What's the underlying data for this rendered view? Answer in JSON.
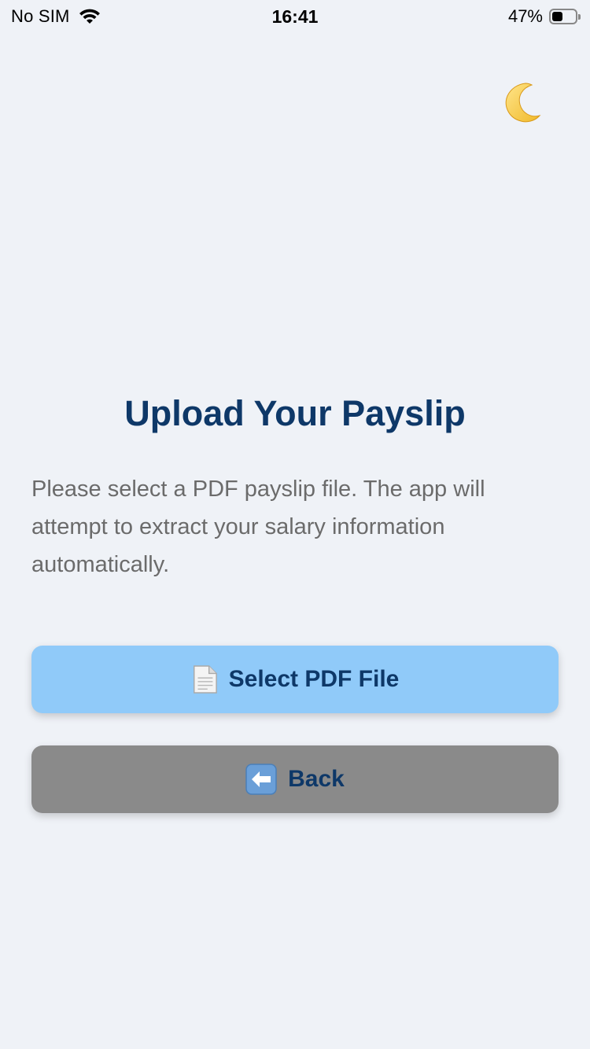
{
  "status_bar": {
    "carrier": "No SIM",
    "time": "16:41",
    "battery_percent": "47%",
    "battery_level": 0.47
  },
  "theme_toggle": {
    "icon": "crescent-moon-icon"
  },
  "upload": {
    "title": "Upload Your Payslip",
    "description": "Please select a PDF payslip file. The app will attempt to extract your salary information automatically.",
    "select_button": {
      "label": "Select PDF File",
      "icon": "document-icon"
    },
    "back_button": {
      "label": "Back",
      "icon": "left-arrow-icon"
    }
  },
  "colors": {
    "background": "#eff2f7",
    "title": "#0e3868",
    "description": "#6b6b6b",
    "select_button_bg": "#90caf9",
    "back_button_bg": "#8a8a8a"
  }
}
